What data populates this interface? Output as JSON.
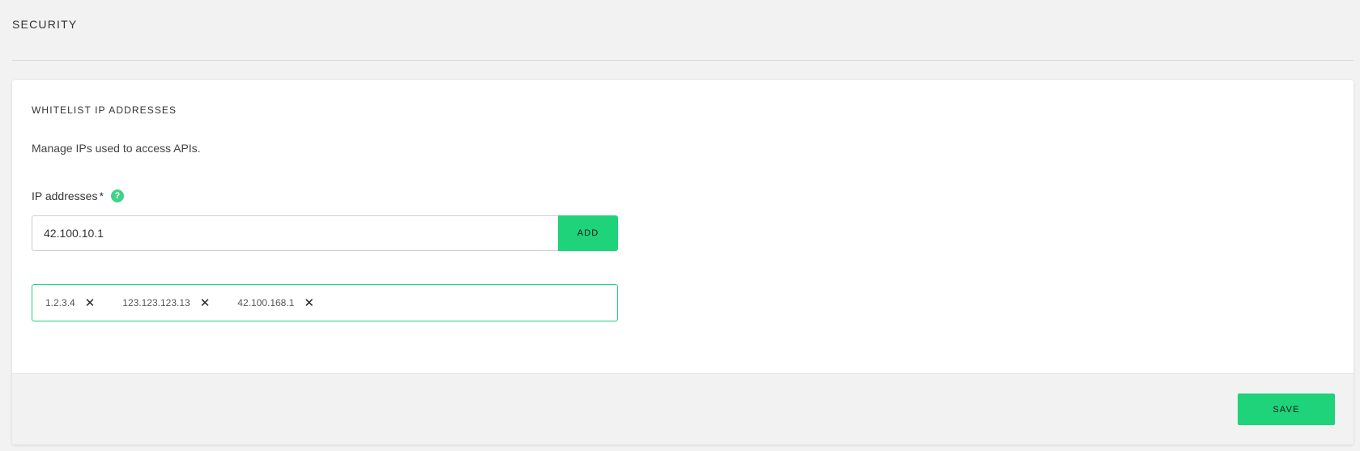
{
  "header": {
    "title": "SECURITY"
  },
  "whitelist": {
    "title": "WHITELIST IP ADDRESSES",
    "description": "Manage IPs used to access APIs.",
    "field_label": "IP addresses",
    "required_mark": "*",
    "help_icon": "question-mark-icon",
    "help_glyph": "?",
    "input_value": "42.100.10.1",
    "add_label": "ADD",
    "tags": [
      {
        "label": "1.2.3.4",
        "remove_icon": "close-icon"
      },
      {
        "label": "123.123.123.13",
        "remove_icon": "close-icon"
      },
      {
        "label": "42.100.168.1",
        "remove_icon": "close-icon"
      }
    ],
    "remove_glyph": "✕"
  },
  "footer": {
    "save_label": "SAVE"
  },
  "colors": {
    "accent": "#1ed37a",
    "help_icon": "#3fd388",
    "background": "#f2f2f2",
    "card": "#ffffff"
  }
}
